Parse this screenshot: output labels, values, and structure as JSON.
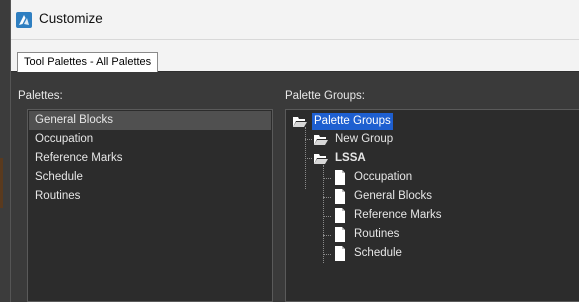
{
  "window": {
    "title": "Customize",
    "app_icon": "autocad-logo-icon"
  },
  "tabs": [
    {
      "label": "Tool Palettes - All Palettes",
      "active": true
    }
  ],
  "palettes": {
    "label": "Palettes:",
    "items": [
      {
        "label": "General Blocks",
        "selected": true
      },
      {
        "label": "Occupation"
      },
      {
        "label": "Reference Marks"
      },
      {
        "label": "Schedule"
      },
      {
        "label": "Routines"
      }
    ]
  },
  "palette_groups": {
    "label": "Palette Groups:",
    "tree": {
      "root": {
        "label": "Palette Groups",
        "icon": "open-folder-icon",
        "selected": true
      },
      "groups": [
        {
          "label": "New Group",
          "icon": "open-folder-icon"
        },
        {
          "label": "LSSA",
          "icon": "open-folder-icon",
          "bold": true,
          "children": [
            {
              "label": "Occupation",
              "icon": "document-icon"
            },
            {
              "label": "General Blocks",
              "icon": "document-icon"
            },
            {
              "label": "Reference Marks",
              "icon": "document-icon"
            },
            {
              "label": "Routines",
              "icon": "document-icon"
            },
            {
              "label": "Schedule",
              "icon": "document-icon"
            }
          ]
        }
      ]
    }
  },
  "colors": {
    "dialog_bg": "#3a3a3a",
    "list_bg": "#2c2c2c",
    "selection_blue": "#1e5fd0",
    "selection_gray": "#505050"
  }
}
